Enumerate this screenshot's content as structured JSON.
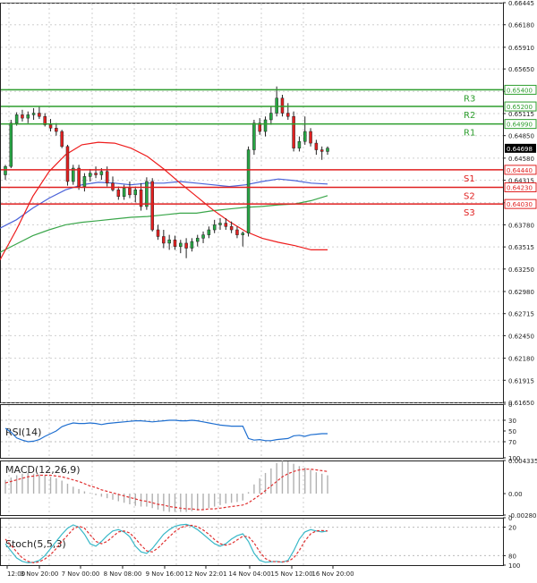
{
  "chart_data": {
    "type": "candlestick",
    "main": {
      "ylim": [
        0.66445,
        0.6165
      ],
      "y_ticks": [
        "0.66445",
        "0.66180",
        "0.65910",
        "0.65650",
        "0.65380",
        "0.65115",
        "0.64850",
        "0.64580",
        "0.64315",
        "0.64045",
        "0.63780",
        "0.63515",
        "0.63250",
        "0.62980",
        "0.62715",
        "0.62450",
        "0.62180",
        "0.61915",
        "0.61650"
      ],
      "x_ticks": [
        "12:00",
        "3 Nov 20:00",
        "7 Nov 00:00",
        "8 Nov 08:00",
        "9 Nov 16:00",
        "12 Nov 22:01",
        "14 Nov 04:00",
        "15 Nov 12:00",
        "16 Nov 20:00"
      ],
      "current_price": "0.64698",
      "levels": [
        {
          "name": "R3",
          "value": 0.654,
          "label": "0.65400",
          "color": "#2e9e2e"
        },
        {
          "name": "R2",
          "value": 0.652,
          "label": "0.65200",
          "color": "#2e9e2e"
        },
        {
          "name": "R1",
          "value": 0.6499,
          "label": "0.64990",
          "color": "#2e9e2e"
        },
        {
          "name": "S1",
          "value": 0.6444,
          "label": "0.64440",
          "color": "#e02020"
        },
        {
          "name": "S2",
          "value": 0.6423,
          "label": "0.64230",
          "color": "#e02020"
        },
        {
          "name": "S3",
          "value": 0.6403,
          "label": "0.64030",
          "color": "#e02020"
        }
      ],
      "candles": [
        [
          0.6438,
          0.645,
          0.6432,
          0.6448
        ],
        [
          0.6448,
          0.6504,
          0.6446,
          0.65
        ],
        [
          0.65,
          0.6513,
          0.6497,
          0.651
        ],
        [
          0.651,
          0.6516,
          0.6502,
          0.6506
        ],
        [
          0.6506,
          0.6514,
          0.65,
          0.651
        ],
        [
          0.651,
          0.6518,
          0.6504,
          0.6512
        ],
        [
          0.6512,
          0.652,
          0.6505,
          0.6508
        ],
        [
          0.6508,
          0.6512,
          0.6496,
          0.6498
        ],
        [
          0.6498,
          0.6505,
          0.649,
          0.6494
        ],
        [
          0.6494,
          0.65,
          0.6485,
          0.649
        ],
        [
          0.649,
          0.6492,
          0.647,
          0.6472
        ],
        [
          0.6472,
          0.6474,
          0.6425,
          0.643
        ],
        [
          0.643,
          0.645,
          0.6426,
          0.6446
        ],
        [
          0.6446,
          0.645,
          0.642,
          0.6424
        ],
        [
          0.6424,
          0.644,
          0.6418,
          0.6436
        ],
        [
          0.6436,
          0.6445,
          0.643,
          0.644
        ],
        [
          0.644,
          0.6448,
          0.6434,
          0.6438
        ],
        [
          0.6438,
          0.6446,
          0.6432,
          0.6442
        ],
        [
          0.6442,
          0.6448,
          0.6424,
          0.6428
        ],
        [
          0.6428,
          0.6436,
          0.6418,
          0.642
        ],
        [
          0.642,
          0.6424,
          0.6408,
          0.6412
        ],
        [
          0.6412,
          0.6426,
          0.6408,
          0.6422
        ],
        [
          0.6422,
          0.643,
          0.641,
          0.6414
        ],
        [
          0.6414,
          0.6424,
          0.6405,
          0.642
        ],
        [
          0.642,
          0.6428,
          0.6395,
          0.64
        ],
        [
          0.64,
          0.6435,
          0.6396,
          0.643
        ],
        [
          0.643,
          0.6434,
          0.637,
          0.6372
        ],
        [
          0.6372,
          0.6378,
          0.636,
          0.6364
        ],
        [
          0.6364,
          0.6372,
          0.635,
          0.6356
        ],
        [
          0.6356,
          0.6366,
          0.6348,
          0.636
        ],
        [
          0.636,
          0.6365,
          0.6348,
          0.6352
        ],
        [
          0.6352,
          0.636,
          0.6344,
          0.6356
        ],
        [
          0.6356,
          0.6362,
          0.6338,
          0.635
        ],
        [
          0.635,
          0.6362,
          0.6346,
          0.6358
        ],
        [
          0.6358,
          0.6366,
          0.6352,
          0.6362
        ],
        [
          0.6362,
          0.637,
          0.6356,
          0.6366
        ],
        [
          0.6366,
          0.6376,
          0.6362,
          0.6372
        ],
        [
          0.6372,
          0.6384,
          0.6368,
          0.6378
        ],
        [
          0.6378,
          0.6386,
          0.6372,
          0.638
        ],
        [
          0.638,
          0.6386,
          0.6372,
          0.6376
        ],
        [
          0.6376,
          0.6382,
          0.6368,
          0.6372
        ],
        [
          0.6372,
          0.6376,
          0.6362,
          0.6366
        ],
        [
          0.6366,
          0.637,
          0.6352,
          0.6368
        ],
        [
          0.6368,
          0.6472,
          0.6364,
          0.6468
        ],
        [
          0.6468,
          0.6504,
          0.6462,
          0.65
        ],
        [
          0.65,
          0.6506,
          0.6486,
          0.649
        ],
        [
          0.649,
          0.6508,
          0.6484,
          0.6504
        ],
        [
          0.6504,
          0.652,
          0.6498,
          0.6512
        ],
        [
          0.6512,
          0.6544,
          0.6508,
          0.653
        ],
        [
          0.653,
          0.6534,
          0.6508,
          0.6512
        ],
        [
          0.6512,
          0.6524,
          0.6504,
          0.6508
        ],
        [
          0.6508,
          0.6514,
          0.6466,
          0.647
        ],
        [
          0.647,
          0.6484,
          0.6466,
          0.6478
        ],
        [
          0.6478,
          0.6508,
          0.6474,
          0.649
        ],
        [
          0.649,
          0.6494,
          0.6472,
          0.6476
        ],
        [
          0.6476,
          0.648,
          0.6462,
          0.6468
        ],
        [
          0.6468,
          0.6472,
          0.6456,
          0.6466
        ],
        [
          0.6466,
          0.6472,
          0.6462,
          0.647
        ]
      ],
      "ma_fast": [
        0.6336,
        0.6372,
        0.6412,
        0.6442,
        0.6462,
        0.6474,
        0.6477,
        0.6476,
        0.647,
        0.646,
        0.6445,
        0.6428,
        0.6412,
        0.6396,
        0.6382,
        0.637,
        0.6362,
        0.6357,
        0.6353,
        0.6348,
        0.6348
      ],
      "ma_medium": [
        0.6374,
        0.6384,
        0.6398,
        0.641,
        0.642,
        0.6426,
        0.6429,
        0.6428,
        0.6426,
        0.6428,
        0.6428,
        0.643,
        0.6428,
        0.6426,
        0.6424,
        0.6426,
        0.643,
        0.6433,
        0.6431,
        0.6428,
        0.6427
      ],
      "ma_slow": [
        0.6345,
        0.6355,
        0.6365,
        0.6372,
        0.6378,
        0.6381,
        0.6383,
        0.6385,
        0.6387,
        0.6388,
        0.639,
        0.6392,
        0.6392,
        0.6395,
        0.6397,
        0.6399,
        0.64,
        0.6402,
        0.6403,
        0.6407,
        0.6413
      ],
      "ma_colors": {
        "fast": "#ee1c1c",
        "medium": "#4b63d9",
        "slow": "#3aa64a"
      }
    },
    "rsi": {
      "label": "RSI(14)",
      "ylim": [
        0,
        100
      ],
      "y_ticks": [
        "100",
        "70",
        "50",
        "30",
        "0"
      ],
      "values": [
        45,
        52,
        63,
        67,
        70,
        69,
        66,
        60,
        55,
        50,
        42,
        38,
        35,
        36,
        36,
        35,
        36,
        38,
        36,
        35,
        34,
        33,
        32,
        31,
        31,
        32,
        33,
        32,
        31,
        30,
        30,
        31,
        31,
        30,
        31,
        33,
        35,
        37,
        39,
        40,
        41,
        41,
        41,
        64,
        67,
        66,
        68,
        68,
        66,
        65,
        64,
        59,
        58,
        60,
        57,
        56,
        55,
        55
      ],
      "color": "#1f6fd0"
    },
    "macd": {
      "label": "MACD(12,26,9)",
      "ylim": [
        0.004335,
        -0.002807
      ],
      "y_ticks": [
        "0.004335",
        "0.00",
        "-0.002807"
      ],
      "hist": [
        0.0018,
        0.0021,
        0.0024,
        0.0026,
        0.0027,
        0.0026,
        0.0025,
        0.0024,
        0.0022,
        0.002,
        0.0017,
        0.0013,
        0.0009,
        0.0006,
        0.0003,
        0.0001,
        -0.0002,
        -0.0004,
        -0.0006,
        -0.0008,
        -0.001,
        -0.0012,
        -0.0014,
        -0.0016,
        -0.0017,
        -0.0017,
        -0.0019,
        -0.0021,
        -0.0023,
        -0.0024,
        -0.0024,
        -0.0024,
        -0.0024,
        -0.0023,
        -0.0022,
        -0.0021,
        -0.0019,
        -0.0017,
        -0.0015,
        -0.0013,
        -0.0012,
        -0.0011,
        -0.0009,
        0.0002,
        0.0012,
        0.002,
        0.0027,
        0.0033,
        0.004,
        0.0043,
        0.0042,
        0.0039,
        0.0036,
        0.0034,
        0.0031,
        0.0028,
        0.0026,
        0.0024
      ],
      "signal": [
        0.0014,
        0.0016,
        0.0018,
        0.002,
        0.0022,
        0.0023,
        0.0024,
        0.0024,
        0.0024,
        0.0023,
        0.0022,
        0.002,
        0.0018,
        0.0016,
        0.0013,
        0.001,
        0.0008,
        0.0005,
        0.0003,
        0.0001,
        -0.0001,
        -0.0003,
        -0.0005,
        -0.0007,
        -0.0009,
        -0.001,
        -0.0012,
        -0.0014,
        -0.0015,
        -0.0017,
        -0.0018,
        -0.0019,
        -0.002,
        -0.002,
        -0.0021,
        -0.0021,
        -0.002,
        -0.002,
        -0.0019,
        -0.0018,
        -0.0017,
        -0.0016,
        -0.0015,
        -0.0012,
        -0.0007,
        -0.0002,
        0.0004,
        0.001,
        0.0016,
        0.0022,
        0.0026,
        0.0029,
        0.0031,
        0.0032,
        0.0032,
        0.0031,
        0.003,
        0.0029
      ],
      "hist_color": "#b0b0b0",
      "signal_color": "#e03030"
    },
    "stoch": {
      "label": "Stoch(5,5,3)",
      "ylim": [
        0,
        100
      ],
      "y_ticks": [
        "100",
        "80",
        "20",
        "0"
      ],
      "k": [
        55,
        70,
        85,
        92,
        95,
        94,
        90,
        80,
        65,
        50,
        35,
        22,
        15,
        20,
        35,
        55,
        60,
        50,
        38,
        28,
        25,
        30,
        40,
        60,
        72,
        75,
        65,
        50,
        35,
        25,
        18,
        15,
        14,
        18,
        25,
        35,
        45,
        55,
        60,
        55,
        45,
        38,
        34,
        50,
        75,
        90,
        94,
        93,
        92,
        94,
        90,
        70,
        45,
        30,
        25,
        28,
        30,
        28
      ],
      "d": [
        45,
        58,
        72,
        85,
        92,
        95,
        93,
        87,
        78,
        65,
        50,
        37,
        24,
        18,
        22,
        36,
        50,
        55,
        50,
        40,
        30,
        28,
        32,
        44,
        58,
        70,
        72,
        64,
        52,
        40,
        29,
        21,
        17,
        16,
        19,
        26,
        35,
        46,
        55,
        58,
        55,
        47,
        39,
        40,
        53,
        72,
        86,
        92,
        93,
        93,
        92,
        85,
        69,
        49,
        34,
        28,
        27,
        28
      ],
      "k_color": "#38b8c8",
      "d_color": "#e03030"
    }
  }
}
